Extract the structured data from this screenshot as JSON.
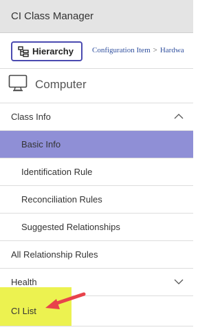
{
  "app": {
    "title": "CI Class Manager"
  },
  "toolbar": {
    "hierarchy_button_label": "Hierarchy",
    "breadcrumb": [
      "Configuration Item",
      "Hardwa"
    ],
    "breadcrumb_separator": ">"
  },
  "ci_class": {
    "name": "Computer",
    "icon": "computer-monitor-icon"
  },
  "nav": {
    "class_info": {
      "label": "Class Info",
      "expanded": true
    },
    "class_info_items": [
      {
        "label": "Basic Info",
        "selected": true
      },
      {
        "label": "Identification Rule",
        "selected": false
      },
      {
        "label": "Reconciliation Rules",
        "selected": false
      },
      {
        "label": "Suggested Relationships",
        "selected": false
      }
    ],
    "all_relationship_rules": {
      "label": "All Relationship Rules"
    },
    "health": {
      "label": "Health",
      "expanded": false
    },
    "ci_list": {
      "label": "CI List",
      "highlighted": true
    }
  },
  "colors": {
    "selected_bg": "#8f8fd6",
    "highlight": "#ecf250",
    "annotation_arrow": "#e8434b",
    "button_border": "#4a4ab0",
    "breadcrumb_link": "#2f4f9e"
  }
}
